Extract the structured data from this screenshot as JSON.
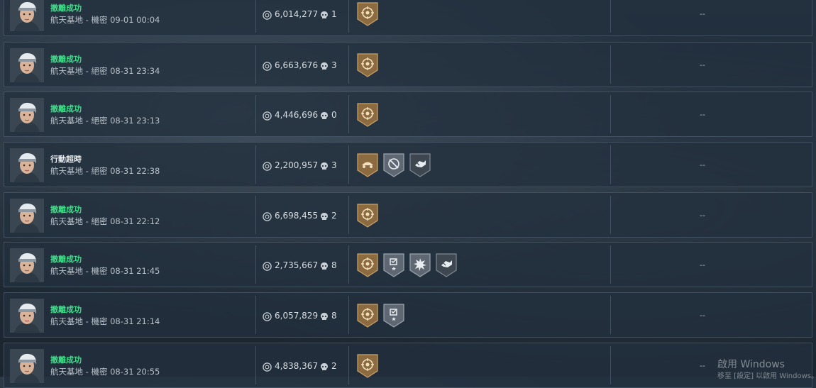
{
  "rows": [
    {
      "status": "撤離成功",
      "status_kind": "success",
      "map_line": "航天基地 - 機密 09-01 00:04",
      "money": "6,014,277",
      "kills": "1",
      "badges": [
        "bronze-crest"
      ],
      "extra": "--"
    },
    {
      "status": "撤離成功",
      "status_kind": "success",
      "map_line": "航天基地 - 絕密 08-31 23:34",
      "money": "6,663,676",
      "kills": "3",
      "badges": [
        "bronze-crest"
      ],
      "extra": "--"
    },
    {
      "status": "撤離成功",
      "status_kind": "success",
      "map_line": "航天基地 - 絕密 08-31 23:13",
      "money": "4,446,696",
      "kills": "0",
      "badges": [
        "bronze-crest"
      ],
      "extra": "--"
    },
    {
      "status": "行動超時",
      "status_kind": "timeout",
      "map_line": "航天基地 - 絕密 08-31 22:38",
      "money": "2,200,957",
      "kills": "3",
      "badges": [
        "bronze-vehicle",
        "silver-crosshair",
        "dark-hand"
      ],
      "extra": "--"
    },
    {
      "status": "撤離成功",
      "status_kind": "success",
      "map_line": "航天基地 - 絕密 08-31 22:12",
      "money": "6,698,455",
      "kills": "2",
      "badges": [
        "bronze-crest"
      ],
      "extra": "--"
    },
    {
      "status": "撤離成功",
      "status_kind": "success",
      "map_line": "航天基地 - 機密 08-31 21:45",
      "money": "2,735,667",
      "kills": "8",
      "badges": [
        "bronze-crest",
        "silver-shield-star",
        "silver-burst",
        "dark-hand"
      ],
      "extra": "--"
    },
    {
      "status": "撤離成功",
      "status_kind": "success",
      "map_line": "航天基地 - 機密 08-31 21:14",
      "money": "6,057,829",
      "kills": "8",
      "badges": [
        "bronze-crest",
        "silver-shield-star"
      ],
      "extra": "--"
    },
    {
      "status": "撤離成功",
      "status_kind": "success",
      "map_line": "航天基地 - 機密 08-31 20:55",
      "money": "4,838,367",
      "kills": "2",
      "badges": [
        "bronze-crest"
      ],
      "extra": "--"
    }
  ],
  "watermark": {
    "title": "啟用 Windows",
    "subtitle": "移至 [設定] 以啟用 Windows。"
  },
  "colors": {
    "success": "#3fe08a",
    "timeout": "#e8ecef",
    "bronze": "#8a6a3e",
    "silver": "#5d6670"
  },
  "icons": {
    "money": "coin-icon",
    "kills": "skull-icon",
    "avatar": "operator-portrait-icon"
  }
}
